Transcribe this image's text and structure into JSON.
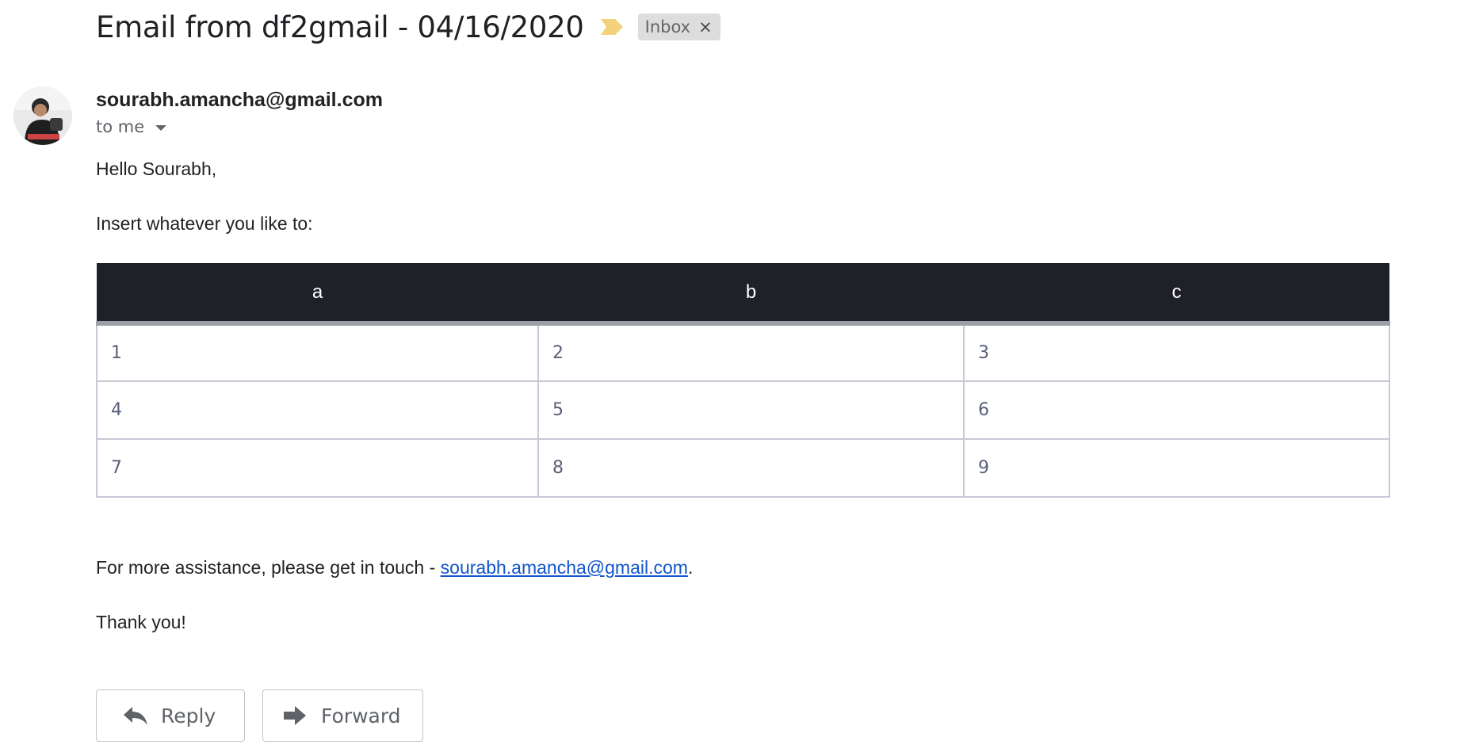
{
  "email": {
    "subject": "Email from df2gmail - 04/16/2020",
    "label": "Inbox",
    "label_remove": "×",
    "sender": "sourabh.amancha@gmail.com",
    "recipient": "to me",
    "greeting": "Hello Sourabh,",
    "intro": "Insert whatever you like to:",
    "assist_prefix": "For more assistance, please get in touch - ",
    "assist_link": "sourabh.amancha@gmail.com",
    "assist_suffix": ".",
    "thanks": "Thank you!"
  },
  "table": {
    "headers": [
      "a",
      "b",
      "c"
    ],
    "rows": [
      [
        "1",
        "2",
        "3"
      ],
      [
        "4",
        "5",
        "6"
      ],
      [
        "7",
        "8",
        "9"
      ]
    ]
  },
  "actions": {
    "reply_label": "Reply",
    "forward_label": "Forward"
  },
  "icons": {
    "importance": "importance-marker-icon",
    "reply": "reply-arrow-icon",
    "forward": "forward-arrow-icon",
    "dropdown": "caret-down-icon"
  },
  "colors": {
    "importance": "#f2d27a",
    "link": "#1155cc",
    "table_header_bg": "#1f2028",
    "table_header_border": "#9aa0a6",
    "cell_text": "#5a607a",
    "label_chip_bg": "#dddddd"
  }
}
